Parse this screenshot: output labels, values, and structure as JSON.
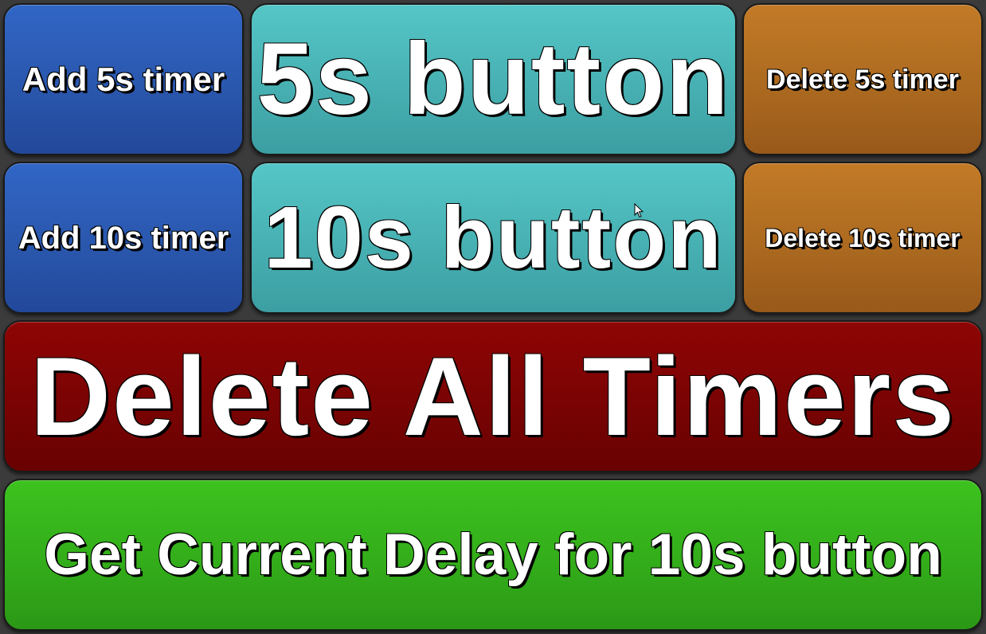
{
  "buttons": {
    "add_5s": "Add 5s timer",
    "btn_5s": "5s button",
    "delete_5s": "Delete 5s timer",
    "add_10s": "Add 10s timer",
    "btn_10s": "10s button",
    "delete_10s": "Delete 10s timer",
    "delete_all": "Delete All Timers",
    "get_delay": "Get Current Delay for 10s button"
  },
  "colors": {
    "background": "#3b3b3b",
    "blue": "#2a57ad",
    "teal": "#47b0b2",
    "orange": "#ac6a20",
    "red": "#7a0303",
    "green": "#33ad1a"
  },
  "icons": {
    "cursor": "mouse-pointer-icon"
  }
}
